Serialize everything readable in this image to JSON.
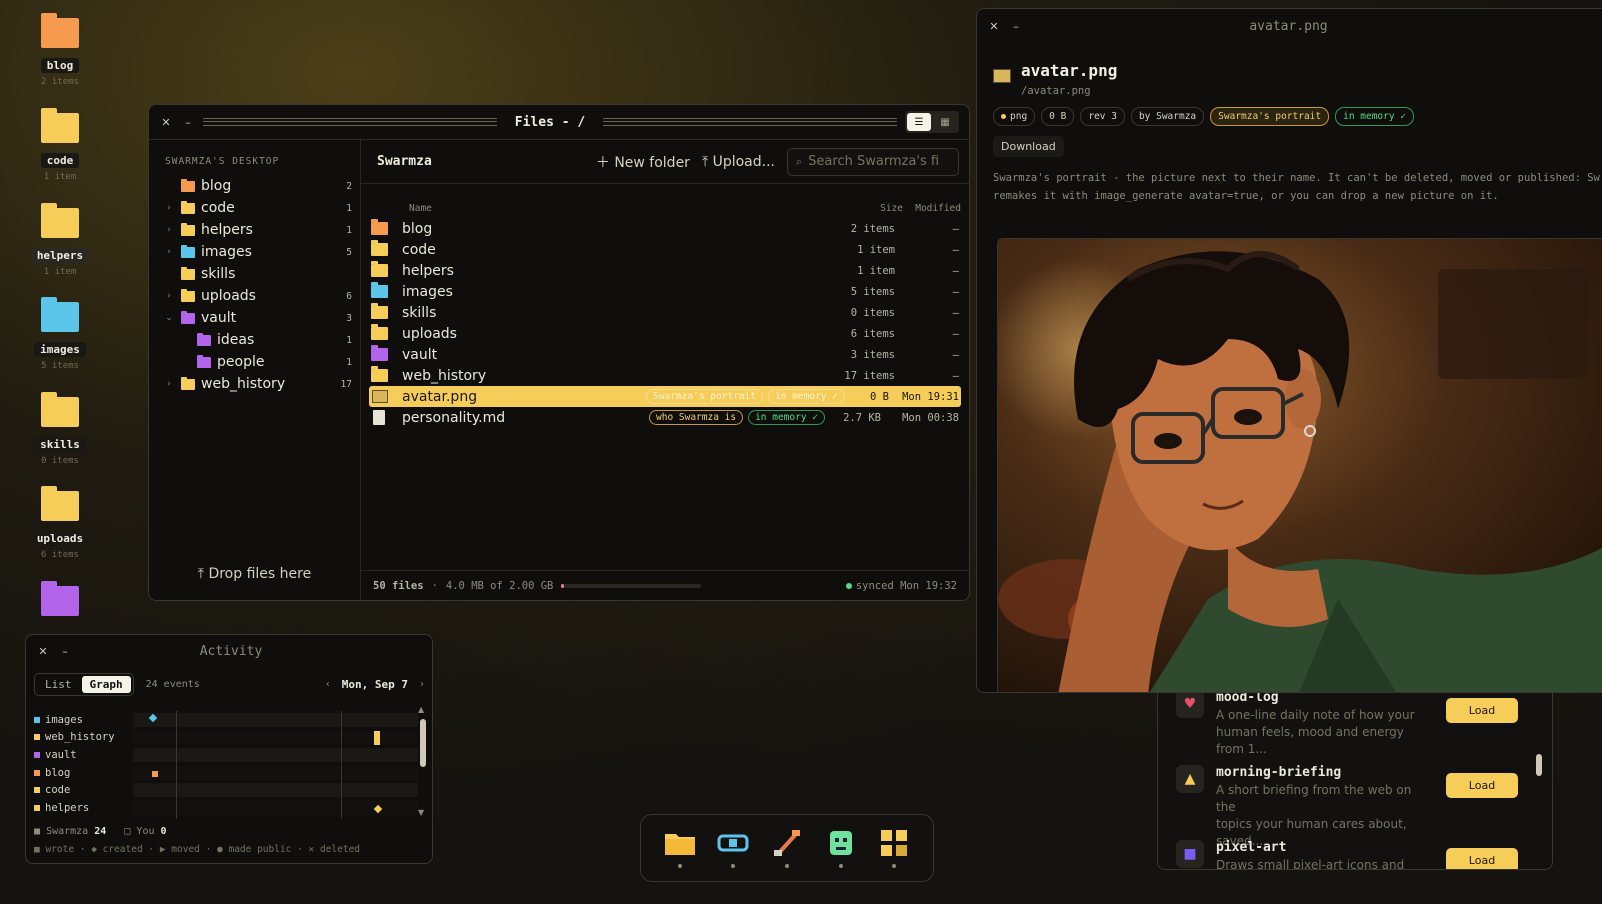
{
  "desktop": {
    "icons": [
      {
        "label": "blog",
        "sub": "2 items",
        "color": "#f59a4e"
      },
      {
        "label": "code",
        "sub": "1 item",
        "color": "#f7cd5a"
      },
      {
        "label": "helpers",
        "sub": "1 item",
        "color": "#f7cd5a"
      },
      {
        "label": "images",
        "sub": "5 items",
        "color": "#5cc6ea"
      },
      {
        "label": "skills",
        "sub": "0 items",
        "color": "#f7cd5a"
      },
      {
        "label": "uploads",
        "sub": "6 items",
        "color": "#f7cd5a"
      },
      {
        "label": "",
        "sub": "",
        "color": "#b264ea"
      }
    ]
  },
  "files": {
    "title": "Files - /",
    "sidebar_heading": "SWARMZA'S DESKTOP",
    "tree": [
      {
        "name": "blog",
        "count": "2",
        "color": "#f59a4e",
        "chevron": ""
      },
      {
        "name": "code",
        "count": "1",
        "color": "#f7cd5a",
        "chevron": "›"
      },
      {
        "name": "helpers",
        "count": "1",
        "color": "#f7cd5a",
        "chevron": "›"
      },
      {
        "name": "images",
        "count": "5",
        "color": "#5cc6ea",
        "chevron": "›"
      },
      {
        "name": "skills",
        "count": "",
        "color": "#f7cd5a",
        "chevron": ""
      },
      {
        "name": "uploads",
        "count": "6",
        "color": "#f7cd5a",
        "chevron": "›"
      },
      {
        "name": "vault",
        "count": "3",
        "color": "#b264ea",
        "chevron": "⌄"
      },
      {
        "name": "ideas",
        "count": "1",
        "color": "#b264ea",
        "chevron": ""
      },
      {
        "name": "people",
        "count": "1",
        "color": "#b264ea",
        "chevron": ""
      },
      {
        "name": "web_history",
        "count": "17",
        "color": "#f7cd5a",
        "chevron": "›"
      }
    ],
    "drop_label": "Drop files here",
    "breadcrumb": "Swarmza",
    "new_folder_label": "New folder",
    "upload_label": "Upload...",
    "search_placeholder": "Search Swarmza's fi",
    "columns": {
      "name": "Name",
      "size": "Size",
      "modified": "Modified"
    },
    "rows": [
      {
        "name": "blog",
        "size": "2 items",
        "modified": "–",
        "color": "#f59a4e"
      },
      {
        "name": "code",
        "size": "1 item",
        "modified": "–",
        "color": "#f7cd5a"
      },
      {
        "name": "helpers",
        "size": "1 item",
        "modified": "–",
        "color": "#f7cd5a"
      },
      {
        "name": "images",
        "size": "5 items",
        "modified": "–",
        "color": "#5cc6ea"
      },
      {
        "name": "skills",
        "size": "0 items",
        "modified": "–",
        "color": "#f7cd5a"
      },
      {
        "name": "uploads",
        "size": "6 items",
        "modified": "–",
        "color": "#f7cd5a"
      },
      {
        "name": "vault",
        "size": "3 items",
        "modified": "–",
        "color": "#b264ea"
      },
      {
        "name": "web_history",
        "size": "17 items",
        "modified": "–",
        "color": "#f7cd5a"
      }
    ],
    "avatar_row": {
      "name": "avatar.png",
      "tag1": "Swarmza's portrait",
      "tag2": "in memory ✓",
      "size": "0 B",
      "modified": "Mon 19:31"
    },
    "personality_row": {
      "name": "personality.md",
      "tag1": "who Swarmza is",
      "tag2": "in memory ✓",
      "size": "2.7 KB",
      "modified": "Mon 00:38"
    },
    "status": {
      "files": "50 files",
      "usage": "4.0 MB of 2.00 GB",
      "usage_fraction": 0.02,
      "synced": "synced Mon 19:32"
    }
  },
  "preview": {
    "title": "avatar.png",
    "name": "avatar.png",
    "path": "/avatar.png",
    "chips": {
      "type": "png",
      "size": "0 B",
      "rev": "rev 3",
      "author": "by Swarmza",
      "tag": "Swarmza's portrait",
      "memory": "in memory ✓"
    },
    "download_label": "Download",
    "desc_line1": "Swarmza's portrait - the picture next to their name. It can't be deleted, moved or published: Sw",
    "desc_line2": "remakes it with image_generate avatar=true, or you can drop a new picture on it."
  },
  "prompts": {
    "items": [
      {
        "name": "mood-log",
        "desc1": "A one-line daily note of how your",
        "desc2": "human feels, mood and energy from 1...",
        "button": "Load"
      },
      {
        "name": "morning-briefing",
        "desc1": "A short briefing from the web on the",
        "desc2": "topics your human cares about, saved...",
        "button": "Load"
      },
      {
        "name": "pixel-art",
        "desc1": "Draws small pixel-art icons and sprites",
        "desc2": "",
        "button": "Load"
      }
    ]
  },
  "activity": {
    "title": "Activity",
    "tab_list": "List",
    "tab_graph": "Graph",
    "events": "24 events",
    "date": "Mon, Sep 7",
    "lanes": [
      {
        "name": "images",
        "color": "#5cc6ea"
      },
      {
        "name": "web_history",
        "color": "#f7cd5a"
      },
      {
        "name": "vault",
        "color": "#b264ea"
      },
      {
        "name": "blog",
        "color": "#f59a4e"
      },
      {
        "name": "code",
        "color": "#f7cd5a"
      },
      {
        "name": "helpers",
        "color": "#f7cd5a"
      }
    ],
    "footer_swarmza_label": "Swarmza",
    "footer_swarmza_count": "24",
    "footer_you_label": "You",
    "footer_you_count": "0",
    "legend": "wrote · ◆ created · ▶ moved · ● made public · ✕ deleted"
  },
  "dock": {
    "items": [
      "folder-icon",
      "eye-icon",
      "paintbrush-icon",
      "robot-icon",
      "grid-icon"
    ]
  }
}
